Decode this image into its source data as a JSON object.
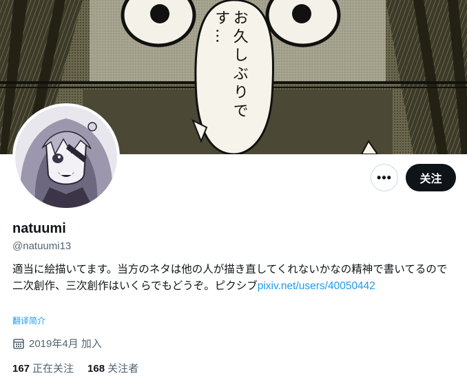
{
  "banner": {
    "speech_text": "お久しぶりです…"
  },
  "actions": {
    "more_label": "•••",
    "follow_label": "关注"
  },
  "profile": {
    "display_name": "natuumi",
    "handle": "@natuumi13",
    "bio_text": "適当に絵描いてます。当方のネタは他の人が描き直してくれないかなの精神で書いてるので二次創作、三次創作はいくらでもどうぞ。ピクシブ",
    "bio_link": "pixiv.net/users/40050442",
    "translate_label": "翻译简介",
    "joined_icon": "calendar-icon",
    "joined_text": "2019年4月 加入"
  },
  "stats": {
    "following_count": "167",
    "following_label": "正在关注",
    "followers_count": "168",
    "followers_label": "关注者"
  },
  "colors": {
    "accent": "#1d9bf0",
    "text_primary": "#0f1419",
    "text_secondary": "#536471",
    "button_dark": "#0f1419"
  }
}
